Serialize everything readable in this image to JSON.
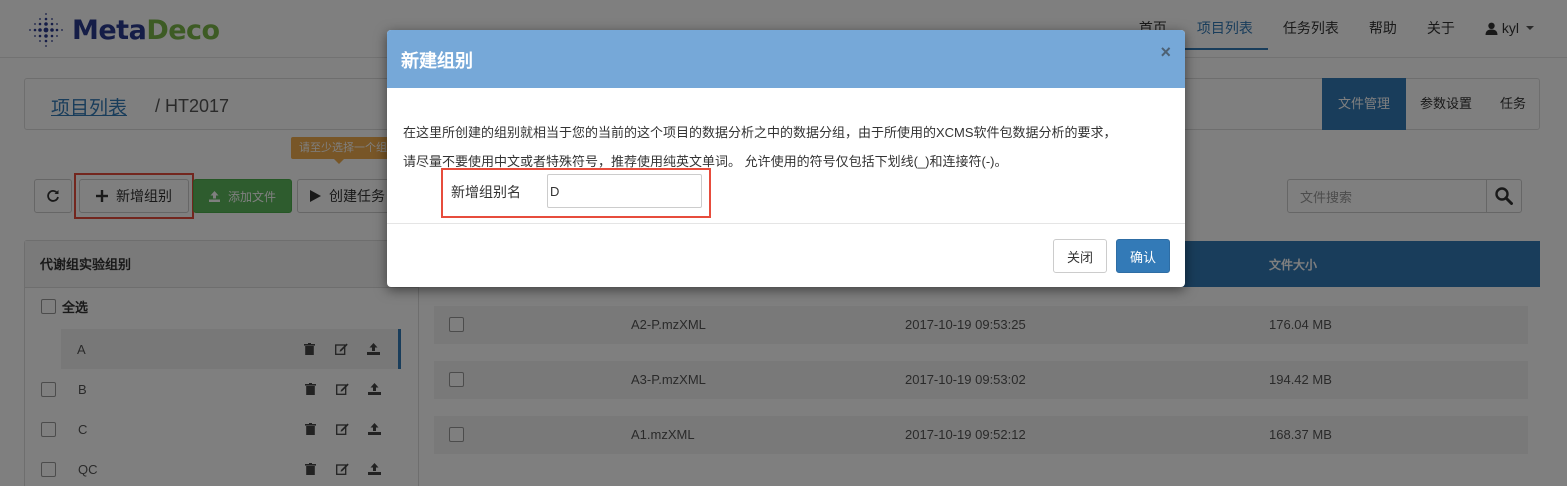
{
  "nav": {
    "logo_part1": "Meta",
    "logo_part2": "Deco",
    "links": [
      "首页",
      "项目列表",
      "任务列表",
      "帮助",
      "关于"
    ],
    "user": "kyl"
  },
  "breadcrumb": {
    "link": "项目列表",
    "current": "/ HT2017"
  },
  "side_tabs": [
    "文件管理",
    "参数设置",
    "任务"
  ],
  "tooltip": "请至少选择一个组别",
  "toolbar": {
    "add_group": "新增组别",
    "add_file": "添加文件",
    "create_task": "创建任务",
    "search_placeholder": "文件搜索"
  },
  "groups": {
    "header": "代谢组实验组别",
    "select_all": "全选",
    "items": [
      "A",
      "B",
      "C",
      "QC"
    ]
  },
  "files": {
    "size_header": "文件大小",
    "rows": [
      {
        "name": "A2-P.mzXML",
        "time": "2017-10-19 09:53:25",
        "size": "176.04 MB"
      },
      {
        "name": "A3-P.mzXML",
        "time": "2017-10-19 09:53:02",
        "size": "194.42 MB"
      },
      {
        "name": "A1.mzXML",
        "time": "2017-10-19 09:52:12",
        "size": "168.37 MB"
      }
    ]
  },
  "modal": {
    "title": "新建组别",
    "close": "×",
    "desc1": "在这里所创建的组别就相当于您的当前的这个项目的数据分析之中的数据分组，由于所使用的XCMS软件包数据分析的要求，",
    "desc2": "请尽量不要使用中文或者特殊符号，推荐使用纯英文单词。 允许使用的符号仅包括下划线(_)和连接符(-)。",
    "field_label": "新增组别名",
    "field_value": "D",
    "btn_close": "关闭",
    "btn_ok": "确认"
  },
  "colors": {
    "primary": "#337ab7",
    "modal_header": "#76a8d8",
    "success": "#5cb85c",
    "warning": "#f0ad4e",
    "highlight": "#e74c3c"
  }
}
